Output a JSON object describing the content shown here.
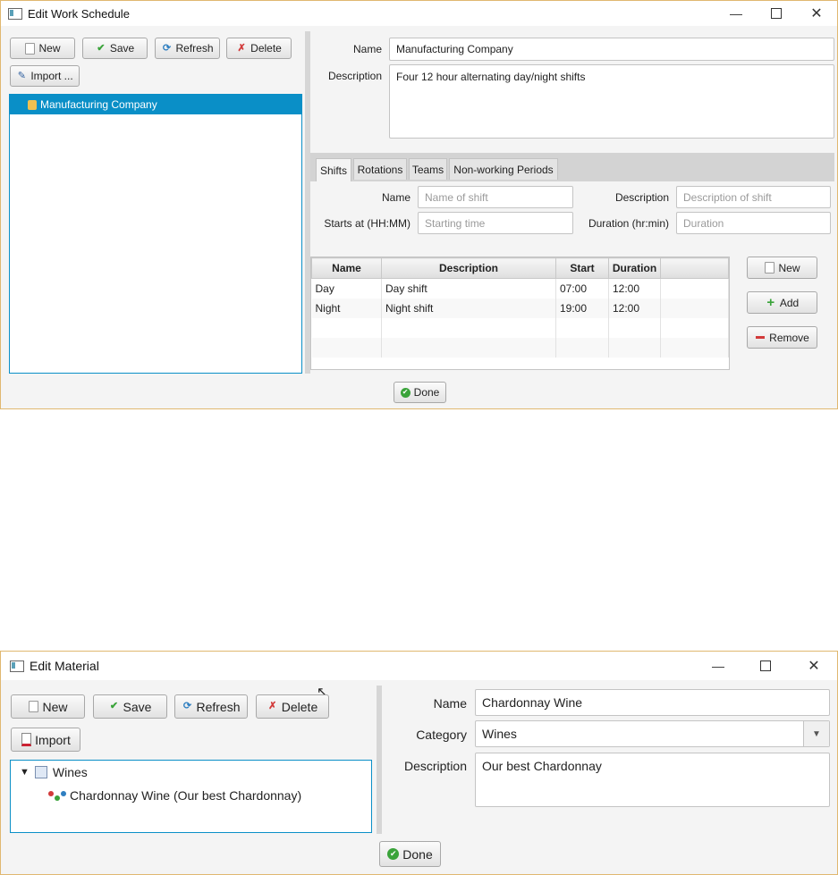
{
  "schedule_window": {
    "title": "Edit Work Schedule",
    "toolbar": {
      "new": "New",
      "save": "Save",
      "refresh": "Refresh",
      "delete": "Delete",
      "import": "Import ..."
    },
    "tree": {
      "selected_item": "Manufacturing Company"
    },
    "form": {
      "name_label": "Name",
      "name_value": "Manufacturing Company",
      "description_label": "Description",
      "description_value": "Four 12 hour alternating day/night shifts"
    },
    "tabs": [
      "Shifts",
      "Rotations",
      "Teams",
      "Non-working Periods"
    ],
    "shift_form": {
      "name_label": "Name",
      "name_placeholder": "Name of shift",
      "description_label": "Description",
      "description_placeholder": "Description of shift",
      "start_label": "Starts at (HH:MM)",
      "start_placeholder": "Starting time",
      "duration_label": "Duration (hr:min)",
      "duration_placeholder": "Duration"
    },
    "table": {
      "columns": [
        "Name",
        "Description",
        "Start",
        "Duration"
      ],
      "rows": [
        [
          "Day",
          "Day shift",
          "07:00",
          "12:00"
        ],
        [
          "Night",
          "Night shift",
          "19:00",
          "12:00"
        ]
      ]
    },
    "side_buttons": {
      "new": "New",
      "add": "Add",
      "remove": "Remove"
    },
    "done": "Done"
  },
  "material_window": {
    "title": "Edit Material",
    "toolbar": {
      "new": "New",
      "save": "Save",
      "refresh": "Refresh",
      "delete": "Delete",
      "import": "Import"
    },
    "tree": {
      "category": "Wines",
      "item": "Chardonnay Wine (Our best Chardonnay)"
    },
    "form": {
      "name_label": "Name",
      "name_value": "Chardonnay Wine",
      "category_label": "Category",
      "category_value": "Wines",
      "description_label": "Description",
      "description_value": "Our best Chardonnay"
    },
    "done": "Done"
  },
  "colors": {
    "selection": "#0a8fc7",
    "window_border": "#e0b870",
    "check_green": "#3aa33a",
    "delete_red": "#d23a3a"
  }
}
